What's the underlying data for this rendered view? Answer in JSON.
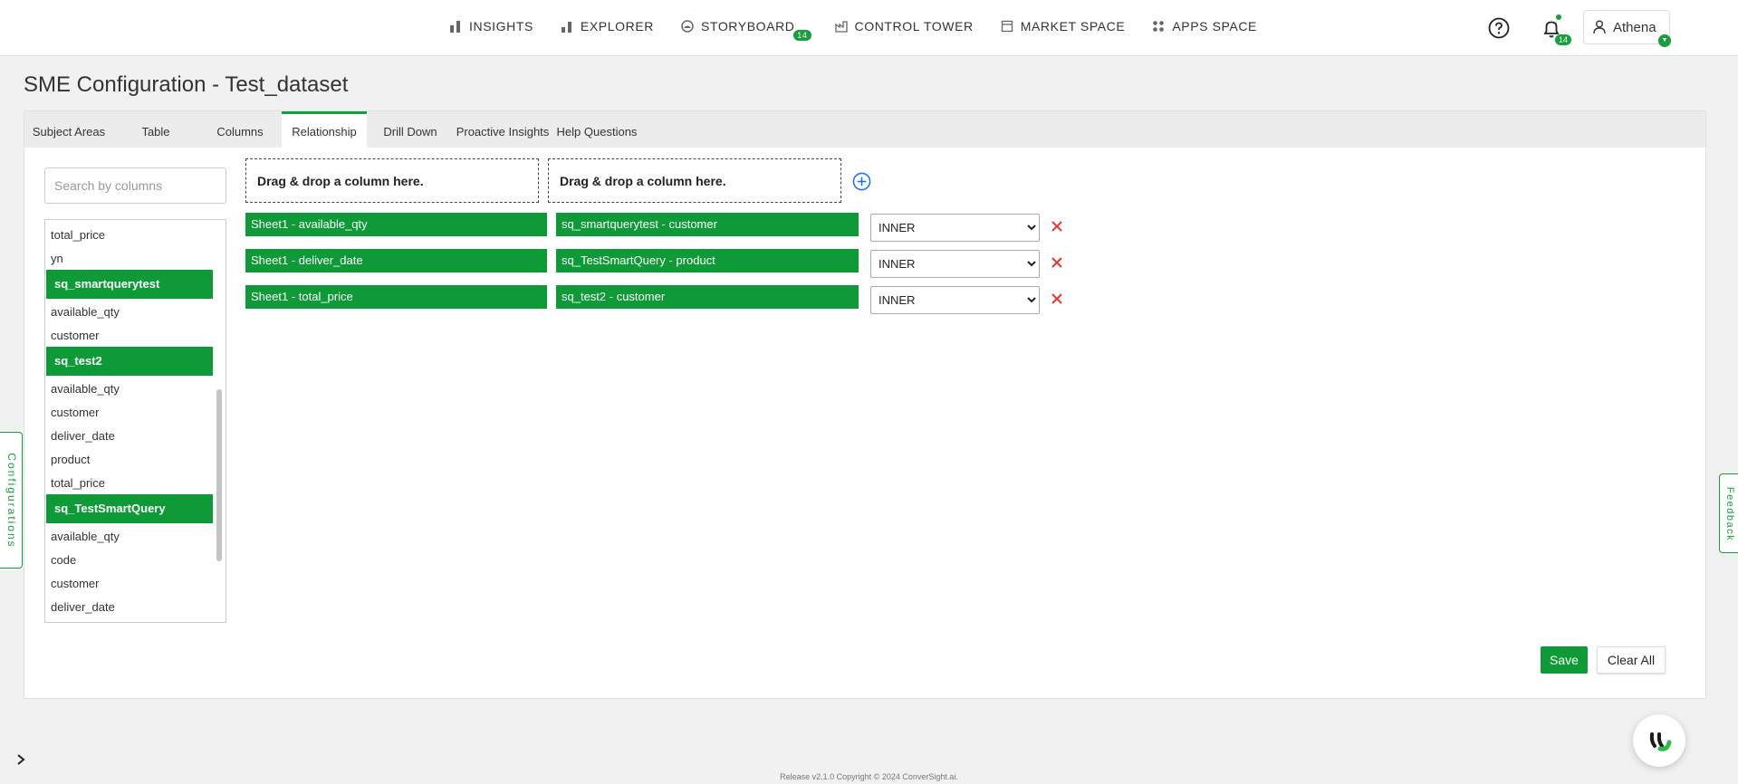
{
  "nav": {
    "items": [
      {
        "label": "INSIGHTS",
        "icon": "bar-chart-icon"
      },
      {
        "label": "EXPLORER",
        "icon": "bar-chart-small-icon"
      },
      {
        "label": "STORYBOARD",
        "icon": "storyboard-icon",
        "badge": "14"
      },
      {
        "label": "CONTROL TOWER",
        "icon": "factory-icon"
      },
      {
        "label": "MARKET SPACE",
        "icon": "store-icon"
      },
      {
        "label": "APPS SPACE",
        "icon": "apps-grid-icon"
      }
    ],
    "notification_count": "14",
    "user_name": "Athena",
    "accent": "#15a03b"
  },
  "page": {
    "title": "SME Configuration - Test_dataset"
  },
  "tabs": [
    {
      "label": "Subject Areas",
      "active": false
    },
    {
      "label": "Table",
      "active": false
    },
    {
      "label": "Columns",
      "active": false
    },
    {
      "label": "Relationship",
      "active": true
    },
    {
      "label": "Drill Down",
      "active": false
    },
    {
      "label": "Proactive Insights",
      "active": false
    },
    {
      "label": "Help Questions",
      "active": false
    }
  ],
  "search": {
    "placeholder": "Search by columns"
  },
  "columns": [
    {
      "label": "total_price",
      "group": false
    },
    {
      "label": "yn",
      "group": false
    },
    {
      "label": "sq_smartquerytest",
      "group": true
    },
    {
      "label": "available_qty",
      "group": false
    },
    {
      "label": "customer",
      "group": false
    },
    {
      "label": "sq_test2",
      "group": true
    },
    {
      "label": "available_qty",
      "group": false
    },
    {
      "label": "customer",
      "group": false
    },
    {
      "label": "deliver_date",
      "group": false
    },
    {
      "label": "product",
      "group": false
    },
    {
      "label": "total_price",
      "group": false
    },
    {
      "label": "sq_TestSmartQuery",
      "group": true
    },
    {
      "label": "available_qty",
      "group": false
    },
    {
      "label": "code",
      "group": false
    },
    {
      "label": "customer",
      "group": false
    },
    {
      "label": "deliver_date",
      "group": false
    }
  ],
  "dropzones": {
    "left": "Drag & drop a column here.",
    "right": "Drag & drop a column here."
  },
  "relationships": [
    {
      "left": "Sheet1 - available_qty",
      "right": "sq_smartquerytest - customer",
      "join": "INNER"
    },
    {
      "left": "Sheet1 - deliver_date",
      "right": "sq_TestSmartQuery - product",
      "join": "INNER"
    },
    {
      "left": "Sheet1 - total_price",
      "right": "sq_test2 - customer",
      "join": "INNER"
    }
  ],
  "buttons": {
    "save": "Save",
    "clear_all": "Clear All"
  },
  "side": {
    "configurations": "Configurations",
    "feedback": "Feedback"
  },
  "footer": "Release v2.1.0 Copyright © 2024 ConverSight.ai."
}
